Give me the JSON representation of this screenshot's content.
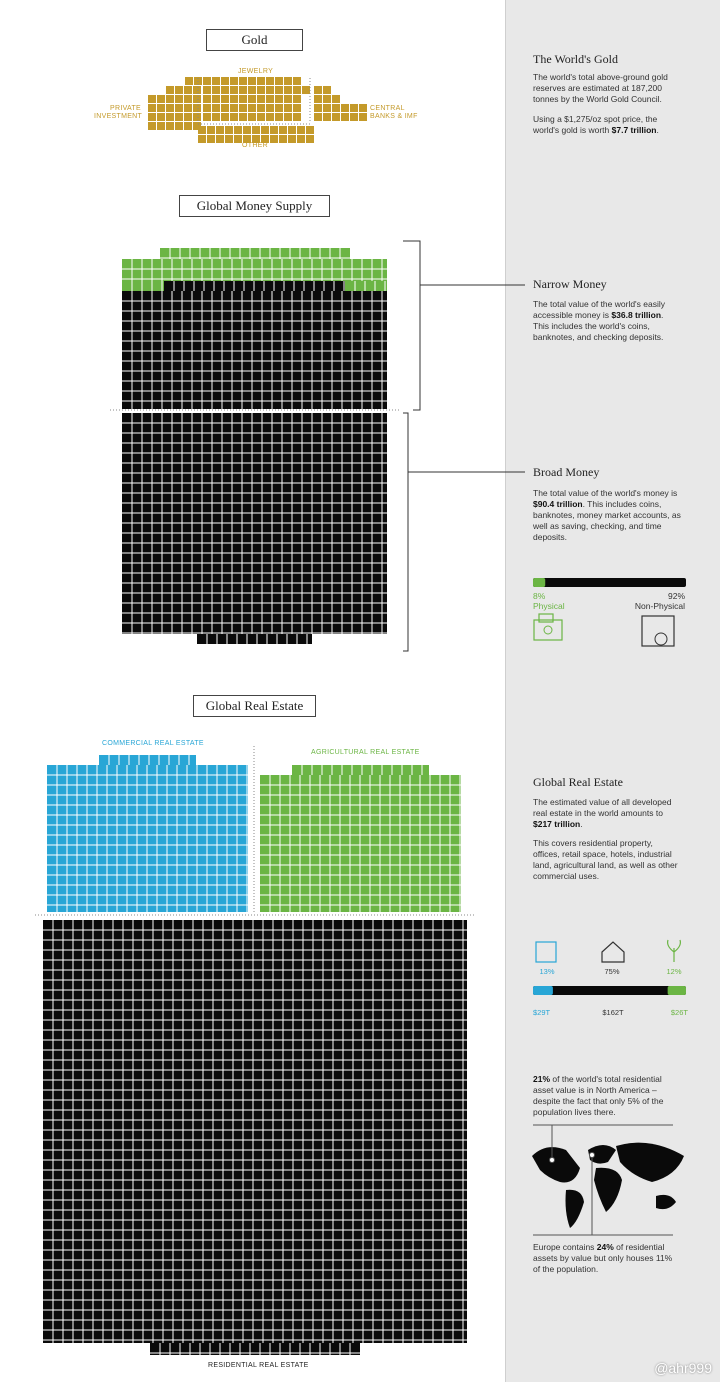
{
  "colors": {
    "gold": "#c49a2a",
    "green": "#6bb544",
    "blue": "#28a6d6",
    "black": "#0a0a0a",
    "sidebar": "#e8e8e8"
  },
  "gold": {
    "title": "Gold",
    "labels": {
      "jewelry": "JEWELRY",
      "private_l1": "PRIVATE",
      "private_l2": "INVESTMENT",
      "central_l1": "CENTRAL",
      "central_l2": "BANKS & IMF",
      "other": "OTHER"
    },
    "side_title": "The World's Gold",
    "side_p1_a": "The world's total above-ground gold reserves are estimated at 187,200 tonnes by the World Gold Council.",
    "side_p2_a": "Using a $1,275/oz spot price, the world's gold is worth ",
    "side_p2_b": "$7.7 trillion",
    "side_p2_c": "."
  },
  "money": {
    "title": "Global Money Supply",
    "narrow_title": "Narrow Money",
    "narrow_a": "The total value of the world's easily accessible money is ",
    "narrow_b": "$36.8 trillion",
    "narrow_c": ". This includes the world's coins, banknotes, and checking deposits.",
    "broad_title": "Broad Money",
    "broad_a": "The total value of the world's money is ",
    "broad_b": "$90.4 trillion",
    "broad_c": ". This includes coins, banknotes, money market accounts, as well as saving, checking, and time deposits.",
    "physical_pct": "8%",
    "physical_label": "Physical",
    "nonphysical_pct": "92%",
    "nonphysical_label": "Non-Physical",
    "physical_share": 0.08
  },
  "realestate": {
    "title": "Global Real Estate",
    "commercial_label": "COMMERCIAL REAL ESTATE",
    "agricultural_label": "AGRICULTURAL REAL ESTATE",
    "residential_label": "RESIDENTIAL REAL ESTATE",
    "side_title": "Global Real Estate",
    "p1_a": "The estimated value of all developed real estate in the world amounts to ",
    "p1_b": "$217 trillion",
    "p1_c": ".",
    "p2": "This covers residential property, offices, retail space, hotels, industrial land, agricultural land, as well as other commercial uses.",
    "pct_commercial": "13%",
    "pct_residential": "75%",
    "pct_agricultural": "12%",
    "val_commercial": "$29T",
    "val_residential": "$162T",
    "val_agricultural": "$26T",
    "na_a": "21%",
    "na_b": " of the world's total residential asset value is in North America – despite the fact that only 5% of the population lives there.",
    "eu_a": "Europe contains ",
    "eu_b": "24%",
    "eu_c": " of residential assets by value but only houses 11% of the population."
  },
  "chart_data": [
    {
      "type": "bar",
      "title": "Gold",
      "categories": [
        "Jewelry",
        "Private Investment",
        "Central Banks & IMF",
        "Other"
      ]
    },
    {
      "type": "bar",
      "title": "Global Money Supply",
      "categories": [
        "Narrow Money",
        "Broad Money"
      ],
      "values": [
        36.8,
        90.4
      ],
      "unit": "trillion USD"
    },
    {
      "type": "bar",
      "title": "Global Real Estate",
      "categories": [
        "Commercial Real Estate",
        "Residential Real Estate",
        "Agricultural Real Estate"
      ],
      "values": [
        29,
        162,
        26
      ],
      "percent": [
        13,
        75,
        12
      ],
      "unit": "trillion USD"
    }
  ]
}
